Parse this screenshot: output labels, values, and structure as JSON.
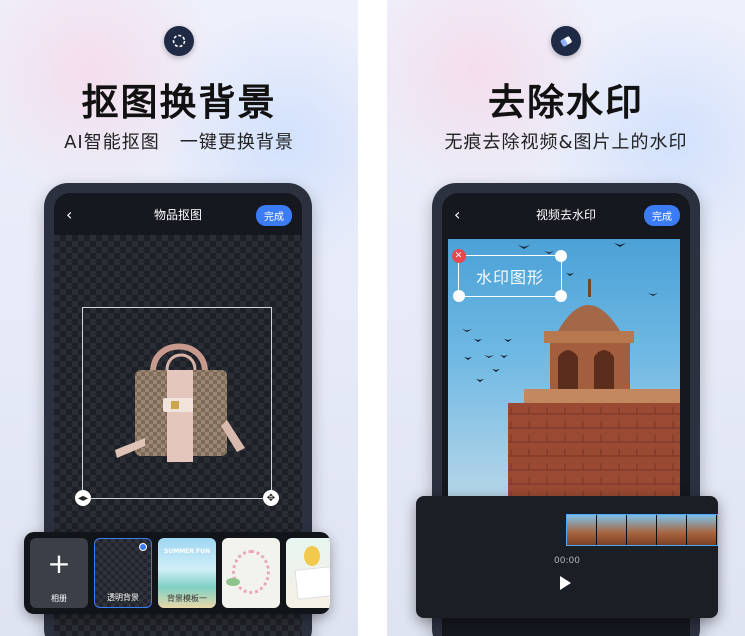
{
  "left": {
    "title": "抠图换背景",
    "subtitle": "AI智能抠图   一键更换背景",
    "screen": {
      "title": "物品抠图",
      "done_label": "完成"
    },
    "tray": [
      {
        "label": "相册",
        "kind": "add"
      },
      {
        "label": "透明背景",
        "kind": "transparent"
      },
      {
        "label": "背景模板一",
        "kind": "beach"
      },
      {
        "label": "",
        "kind": "floral"
      },
      {
        "label": "",
        "kind": "balloons"
      }
    ],
    "tray_inner": {
      "beach_caption": "SUMMER FUN"
    }
  },
  "right": {
    "title": "去除水印",
    "subtitle": "无痕去除视频&图片上的水印",
    "screen": {
      "title": "视频去水印",
      "done_label": "完成",
      "watermark_text": "水印图形"
    },
    "player": {
      "time": "00:00"
    }
  },
  "colors": {
    "accent": "#3b7bf6",
    "phone_frame": "#2c3140",
    "remove_red": "#e5484d"
  }
}
